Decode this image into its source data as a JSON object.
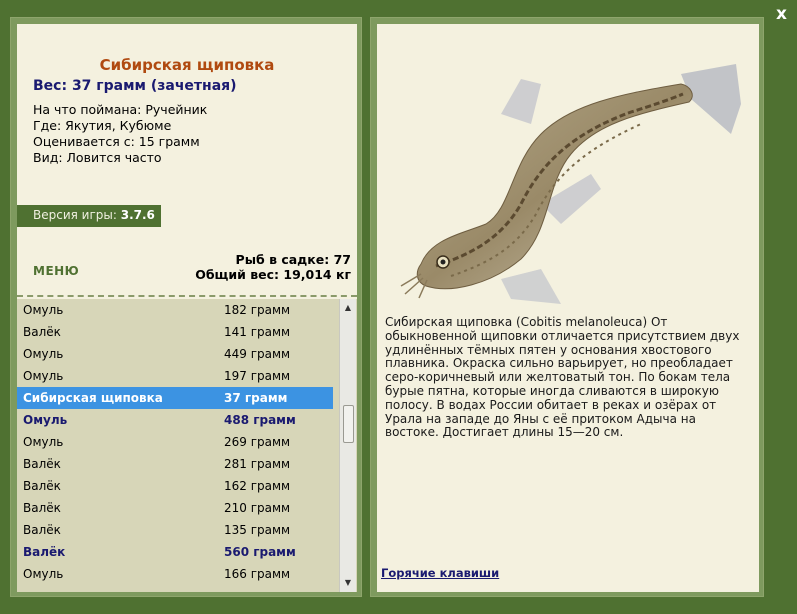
{
  "window": {
    "close_label": "x"
  },
  "fish": {
    "title": "Сибирская щиповка",
    "weight": "Вес: 37 грамм (зачетная)",
    "caught_on": "На что поймана: Ручейник",
    "where": "Где: Якутия, Кубюме",
    "rated_from": "Оценивается с: 15 грамм",
    "kind": "Вид: Ловится часто",
    "description": "Сибирская щиповка (Cobitis melanoleuca) От обыкновенной щиповки отличается присутствием двух удлинённых тёмных пятен у основания хвостового плавника. Окраска сильно варьирует, но преобладает серо-коричневый или желтоватый тон. По бокам тела бурые пятна, которые иногда сливаются в широкую полосу. В водах России обитает в реках и озёрах от Урала на западе до Яны с её притоком Адыча на востоке. Достигает длины 15—20 см."
  },
  "version": {
    "label": "Версия игры: ",
    "value": "3.7.6"
  },
  "menu_label": "МЕНЮ",
  "stats": {
    "fish_in_keepnet": "Рыб в садке: 77",
    "total_weight": "Общий вес: 19,014 кг"
  },
  "catch_list": [
    {
      "name": "Омуль",
      "weight": "182 грамм",
      "style": "normal"
    },
    {
      "name": "Валёк",
      "weight": "141 грамм",
      "style": "normal"
    },
    {
      "name": "Омуль",
      "weight": "449 грамм",
      "style": "normal"
    },
    {
      "name": "Омуль",
      "weight": "197 грамм",
      "style": "normal"
    },
    {
      "name": "Сибирская щиповка",
      "weight": "37 грамм",
      "style": "selected"
    },
    {
      "name": "Омуль",
      "weight": "488 грамм",
      "style": "bold"
    },
    {
      "name": "Омуль",
      "weight": "269 грамм",
      "style": "normal"
    },
    {
      "name": "Валёк",
      "weight": "281 грамм",
      "style": "normal"
    },
    {
      "name": "Валёк",
      "weight": "162 грамм",
      "style": "normal"
    },
    {
      "name": "Валёк",
      "weight": "210 грамм",
      "style": "normal"
    },
    {
      "name": "Валёк",
      "weight": "135 грамм",
      "style": "normal"
    },
    {
      "name": "Валёк",
      "weight": "560 грамм",
      "style": "bold"
    },
    {
      "name": "Омуль",
      "weight": "166 грамм",
      "style": "normal"
    }
  ],
  "hotkeys_label": "Горячие клавиши",
  "colors": {
    "frame_green": "#4f7131",
    "panel_bg": "#f4f1df",
    "list_bg": "#d7d6b8",
    "selected_bg": "#3c93e2",
    "title_orange": "#b04a10",
    "accent_navy": "#1a1a70"
  }
}
